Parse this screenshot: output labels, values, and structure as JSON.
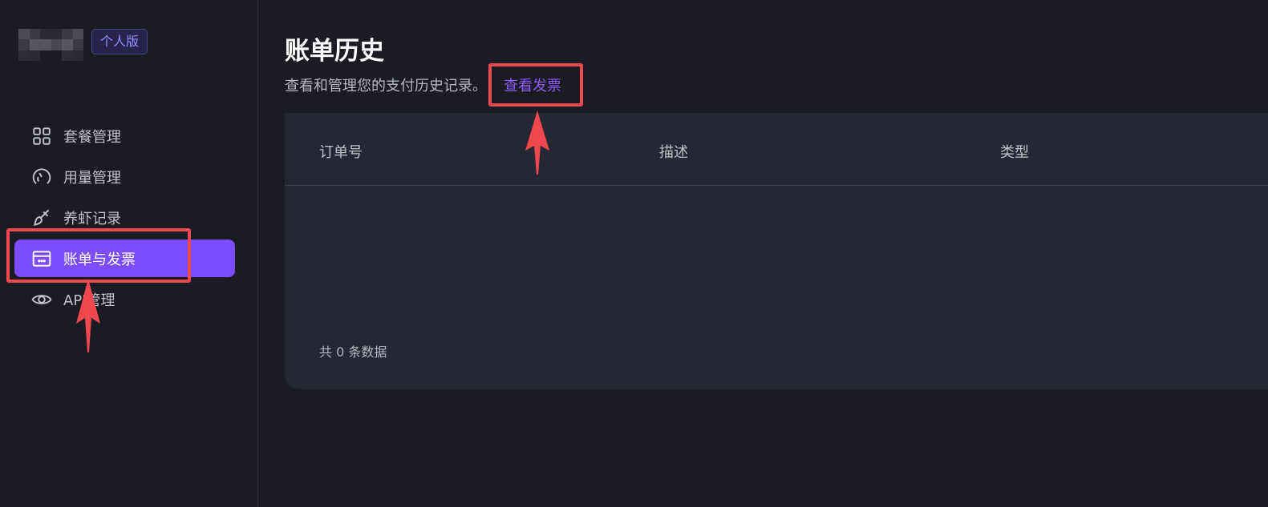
{
  "sidebar": {
    "badge": "个人版",
    "items": [
      {
        "label": "套餐管理",
        "icon": "grid-icon"
      },
      {
        "label": "用量管理",
        "icon": "gauge-icon"
      },
      {
        "label": "养虾记录",
        "icon": "brush-icon"
      },
      {
        "label": "账单与发票",
        "icon": "billing-card-icon",
        "active": true
      },
      {
        "label": "API管理",
        "icon": "eye-icon"
      }
    ]
  },
  "main": {
    "title": "账单历史",
    "subtitle": "查看和管理您的支付历史记录。",
    "invoice_link": "查看发票",
    "table": {
      "columns": [
        "订单号",
        "描述",
        "类型"
      ],
      "rows": [],
      "footer": "共 0 条数据"
    }
  },
  "colors": {
    "accent": "#7c4dff",
    "link": "#8b5cf6",
    "highlight": "#f0484f",
    "background": "#1b1b23"
  }
}
